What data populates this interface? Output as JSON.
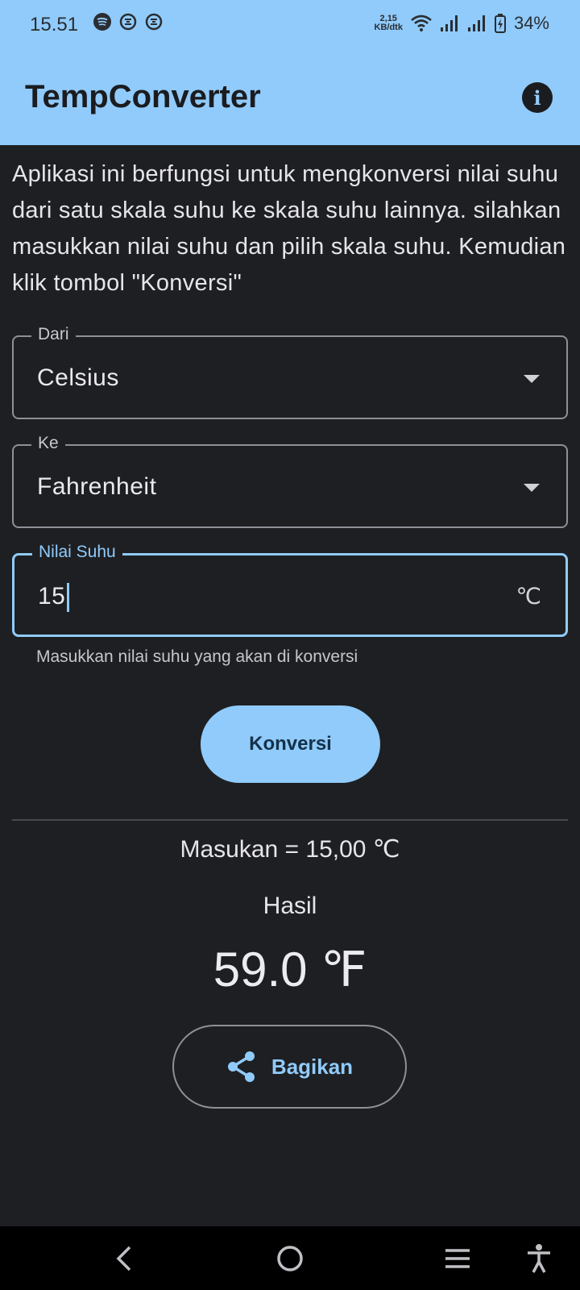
{
  "status_bar": {
    "time": "15.51",
    "net_speed_value": "2,15",
    "net_speed_unit": "KB/dtk",
    "battery": "34%",
    "icons": [
      "spotify-icon",
      "app-icon",
      "app-icon",
      "wifi-icon",
      "signal-icon",
      "signal-icon",
      "battery-charging-icon"
    ]
  },
  "appbar": {
    "title": "TempConverter",
    "info_icon": "info-icon"
  },
  "intro_text": "Aplikasi ini berfungsi untuk mengkonversi nilai suhu dari satu skala suhu ke skala suhu lainnya. silahkan masukkan nilai suhu dan pilih skala suhu. Kemudian klik tombol \"Konversi\"",
  "form": {
    "from": {
      "label": "Dari",
      "value": "Celsius"
    },
    "to": {
      "label": "Ke",
      "value": "Fahrenheit"
    },
    "input": {
      "label": "Nilai Suhu",
      "value": "15",
      "suffix": "℃",
      "helper": "Masukkan nilai suhu yang akan di konversi"
    }
  },
  "convert_button": "Konversi",
  "result": {
    "input_summary": "Masukan = 15,00 ℃",
    "label": "Hasil",
    "value": "59.0 ℉"
  },
  "share_button": {
    "label": "Bagikan",
    "icon": "share-icon"
  },
  "colors": {
    "accent": "#90cbfb",
    "background": "#1e1f22",
    "appbar": "#90cbfb"
  },
  "nav_bar": {
    "icons": [
      "back-icon",
      "home-icon",
      "recents-icon",
      "accessibility-icon"
    ]
  }
}
